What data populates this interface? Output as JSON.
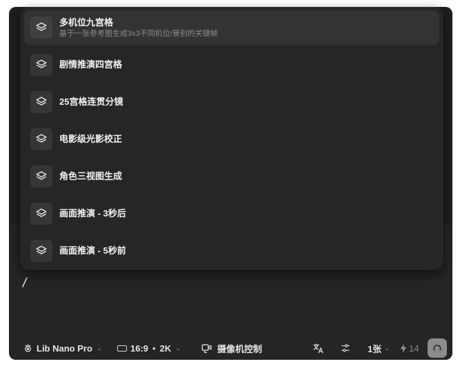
{
  "menu": {
    "items": [
      {
        "title": "多机位九宫格",
        "subtitle": "基于一张参考图生成3x3不同机位/景别的关键帧",
        "icon": "layers-icon"
      },
      {
        "title": "剧情推演四宫格",
        "icon": "layers-icon"
      },
      {
        "title": "25宫格连贯分镜",
        "icon": "layers-icon"
      },
      {
        "title": "电影级光影校正",
        "icon": "layers-icon"
      },
      {
        "title": "角色三视图生成",
        "icon": "layers-icon"
      },
      {
        "title": "画面推演 - 3秒后",
        "icon": "layers-icon"
      },
      {
        "title": "画面推演 - 5秒前",
        "icon": "layers-icon"
      }
    ]
  },
  "editor": {
    "input_value": "/"
  },
  "toolbar": {
    "model_label": "Lib Nano Pro",
    "ratio_label": "16:9",
    "dot": "•",
    "resolution_label": "2K",
    "camera_label": "摄像机控制",
    "count_label": "1张",
    "credits_value": "14"
  },
  "colors": {
    "background": "#1f1f1f",
    "dropdown": "#262626",
    "active_item": "#333333",
    "send_button": "#8c8c8c"
  }
}
